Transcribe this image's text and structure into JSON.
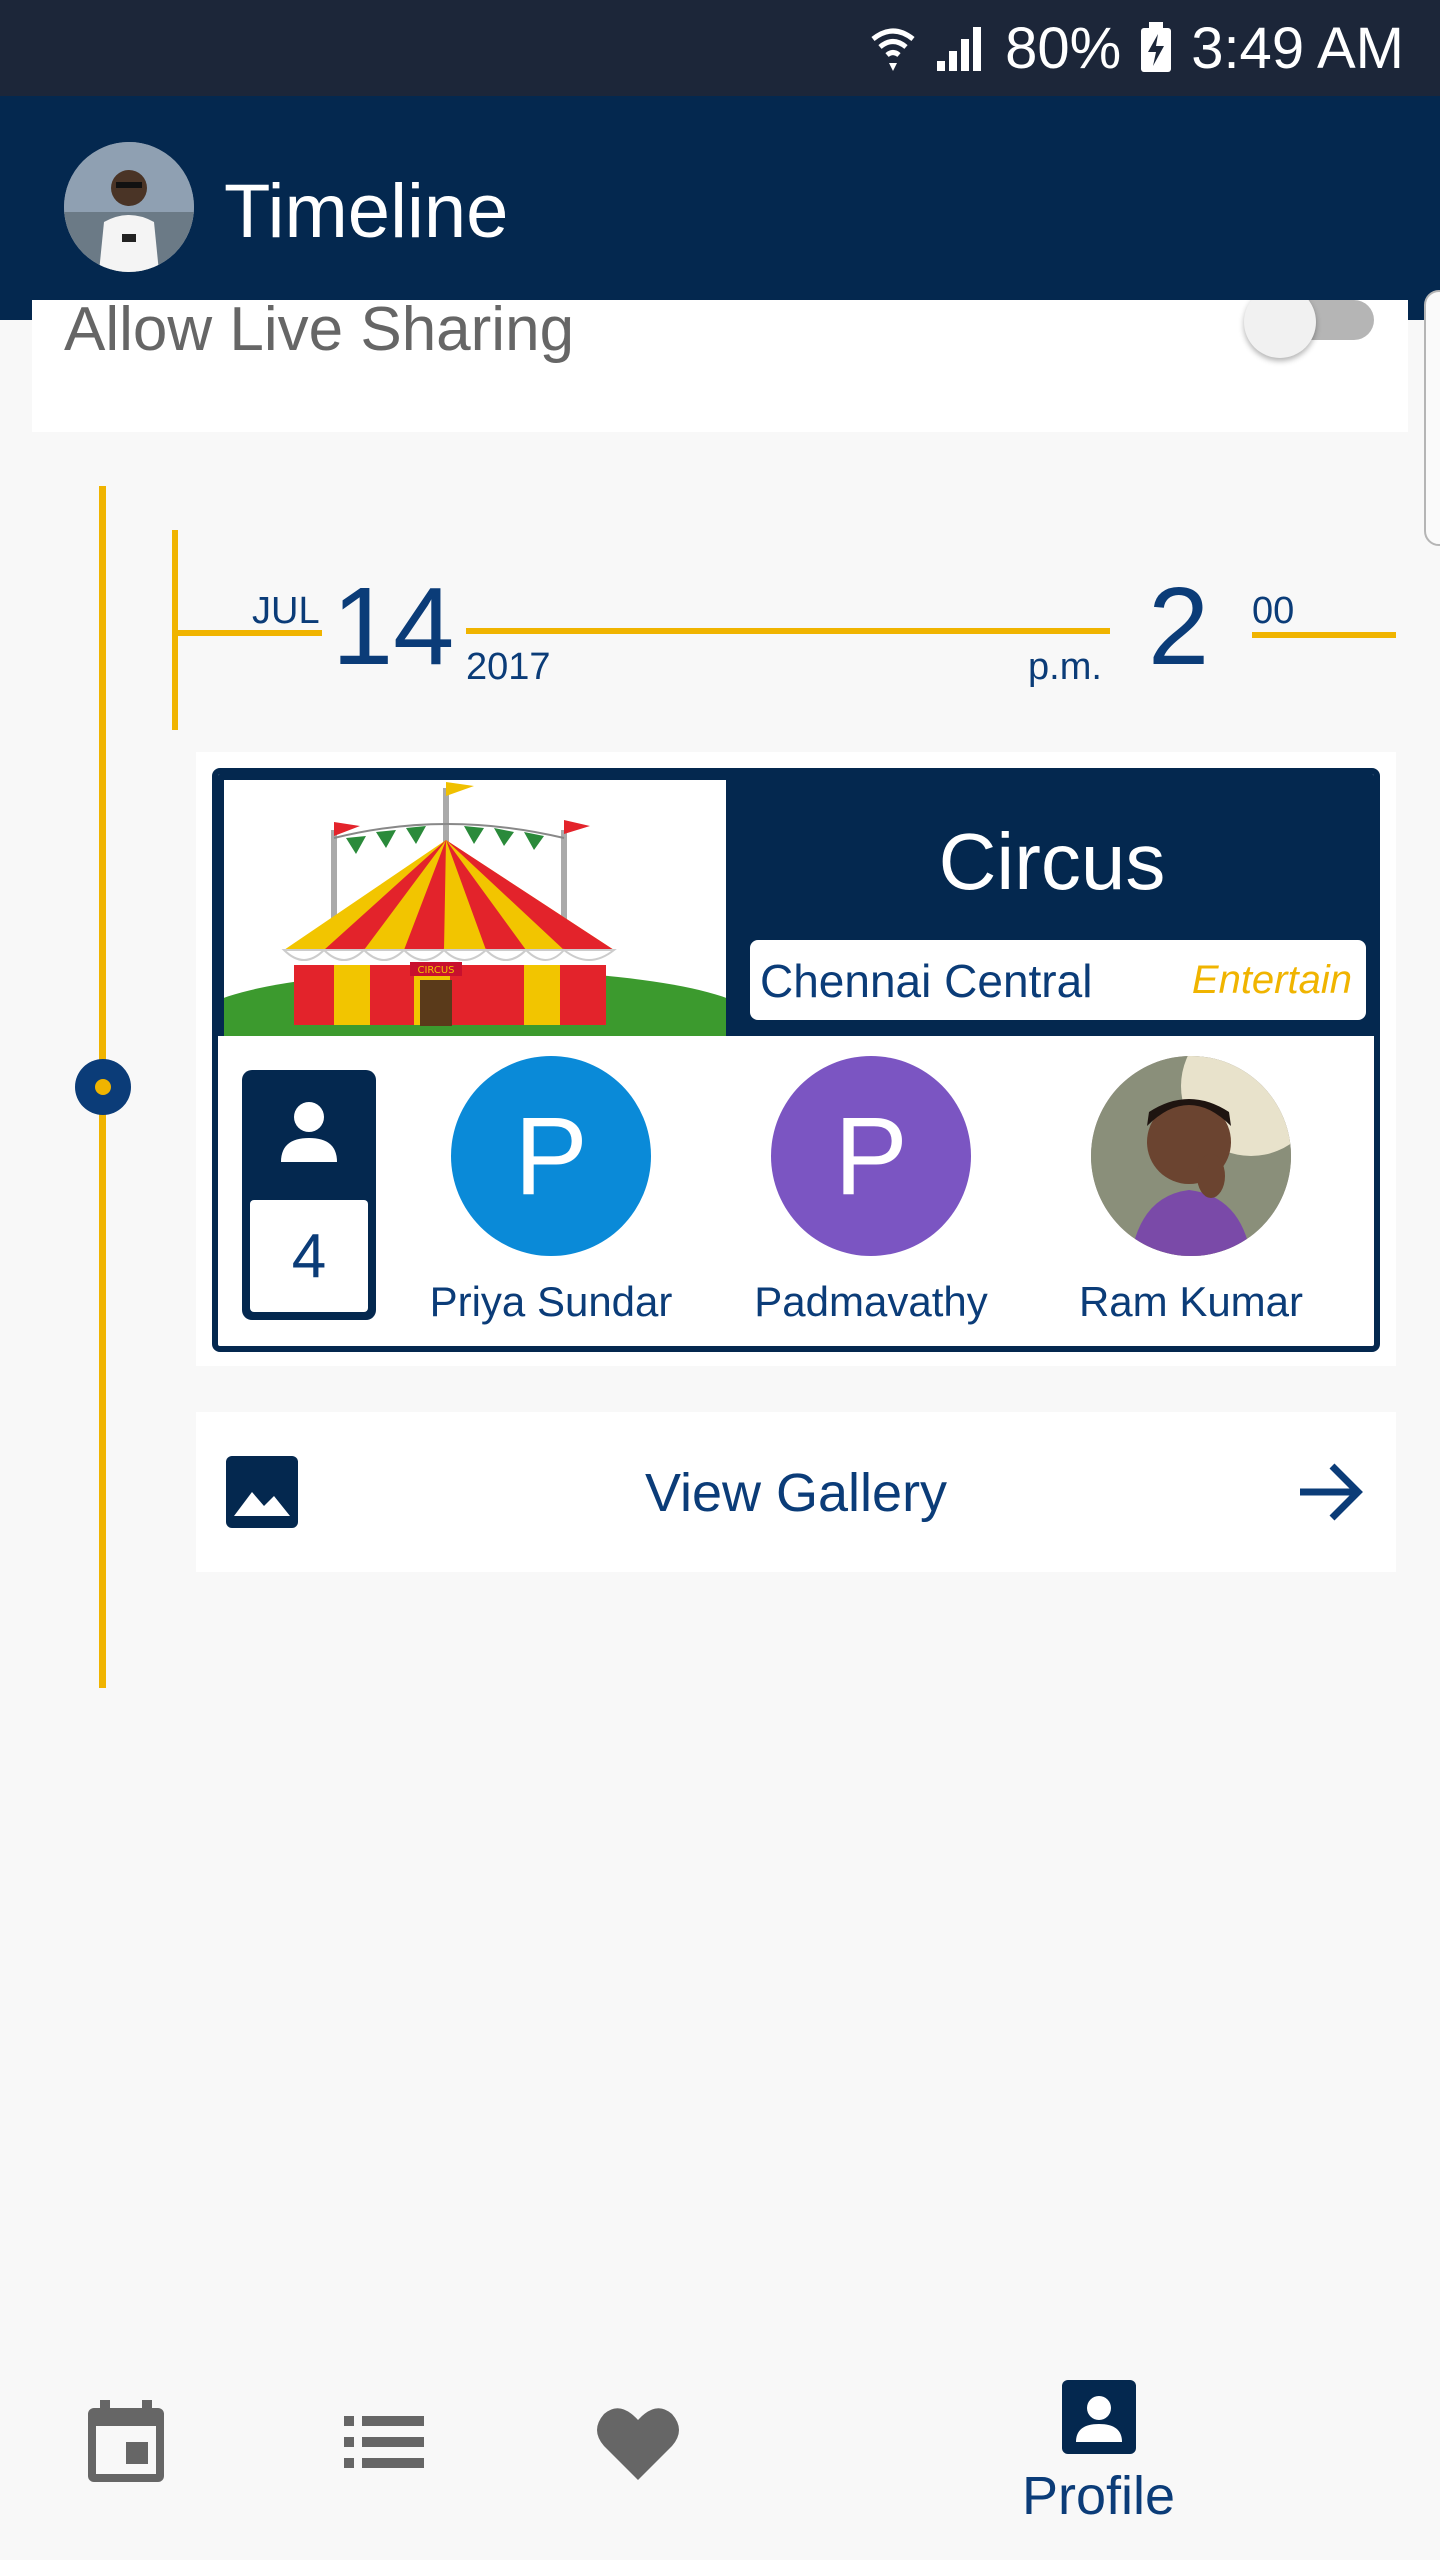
{
  "status_bar": {
    "battery": "80%",
    "time": "3:49 AM"
  },
  "app_bar": {
    "title": "Timeline"
  },
  "sharing": {
    "label": "Allow Live Sharing"
  },
  "event": {
    "month": "JUL",
    "day": "14",
    "year": "2017",
    "ampm": "p.m.",
    "hour": "2",
    "minute": "00",
    "title": "Circus",
    "location": "Chennai Central",
    "category": "Entertain",
    "image_caption": "CIRCUS",
    "attendee_count": "4",
    "attendees": [
      {
        "initial": "P",
        "name": "Priya Sundar",
        "color": "#0a8ad8"
      },
      {
        "initial": "P",
        "name": "Padmavathy",
        "color": "#7b55c2"
      },
      {
        "initial": "",
        "name": "Ram Kumar",
        "color": "#9a8a84"
      }
    ]
  },
  "gallery": {
    "label": "View Gallery"
  },
  "nav": {
    "items": [
      {
        "icon": "calendar-icon"
      },
      {
        "icon": "list-icon"
      },
      {
        "icon": "heart-icon"
      },
      {
        "icon": "profile-icon",
        "label": "Profile"
      }
    ]
  },
  "colors": {
    "navy": "#04284f",
    "accent": "#f0b400",
    "text": "#0b3c78"
  }
}
